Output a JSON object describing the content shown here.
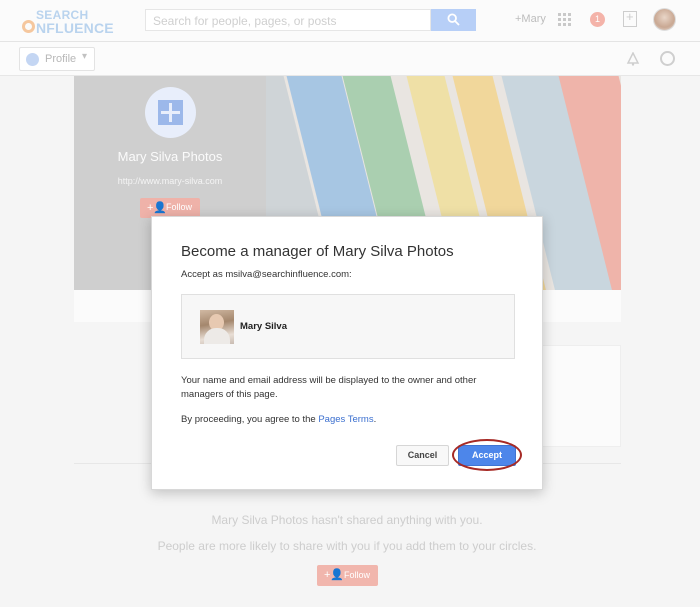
{
  "header": {
    "logo_top": "SEARCH",
    "logo_bottom": "NFLUENCE",
    "search_placeholder": "Search for people, pages, or posts",
    "user_link": "+Mary",
    "notification_count": "1"
  },
  "subnav": {
    "profile_label": "Profile"
  },
  "page": {
    "name": "Mary Silva Photos",
    "url": "http://www.mary-silva.com",
    "follow_label": "Follow"
  },
  "empty_state": {
    "line1": "Mary Silva Photos hasn't shared anything with you.",
    "line2": "People are more likely to share with you if you add them to your circles.",
    "follow_label": "Follow"
  },
  "dialog": {
    "title": "Become a manager of Mary Silva Photos",
    "accept_as": "Accept as msilva@searchinfluence.com:",
    "user_name": "Mary Silva",
    "info": "Your name and email address will be displayed to the owner and other managers of this page.",
    "terms_prefix": "By proceeding, you agree to the ",
    "terms_link": "Pages Terms",
    "terms_suffix": ".",
    "cancel_label": "Cancel",
    "accept_label": "Accept"
  },
  "colors": {
    "accent_blue": "#4d86ea",
    "follow_red": "#efb2a9",
    "highlight_ring": "#a62a25"
  }
}
